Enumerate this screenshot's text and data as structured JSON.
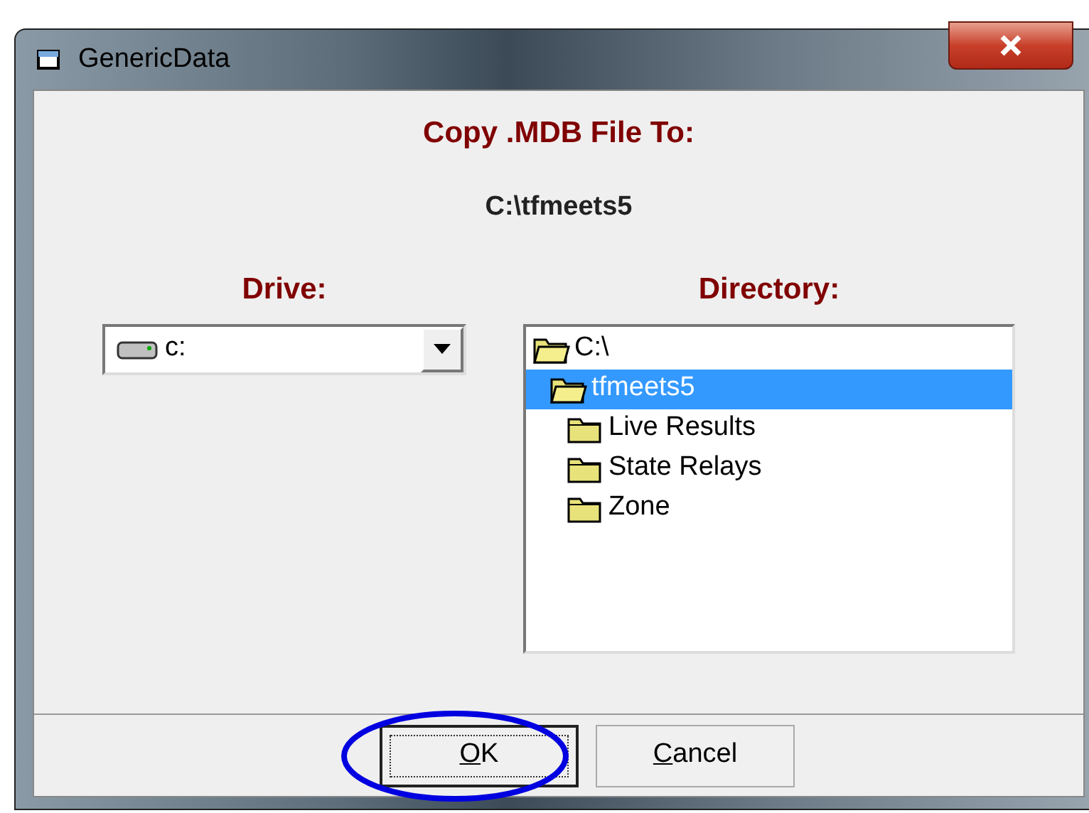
{
  "window": {
    "title": "GenericData"
  },
  "heading": "Copy .MDB File To:",
  "path": "C:\\tfmeets5",
  "drive": {
    "label": "Drive:",
    "value": "c:"
  },
  "directory": {
    "label": "Directory:",
    "tree": [
      {
        "label": "C:\\",
        "selected": false,
        "children": [
          {
            "label": "tfmeets5",
            "selected": true,
            "children": [
              {
                "label": "Live Results",
                "selected": false
              },
              {
                "label": "State Relays",
                "selected": false
              },
              {
                "label": "Zone",
                "selected": false
              }
            ]
          }
        ]
      }
    ]
  },
  "buttons": [
    {
      "label": "OK",
      "focused": true,
      "highlighted": true
    },
    {
      "label": "Cancel",
      "focused": false,
      "highlighted": false
    }
  ]
}
